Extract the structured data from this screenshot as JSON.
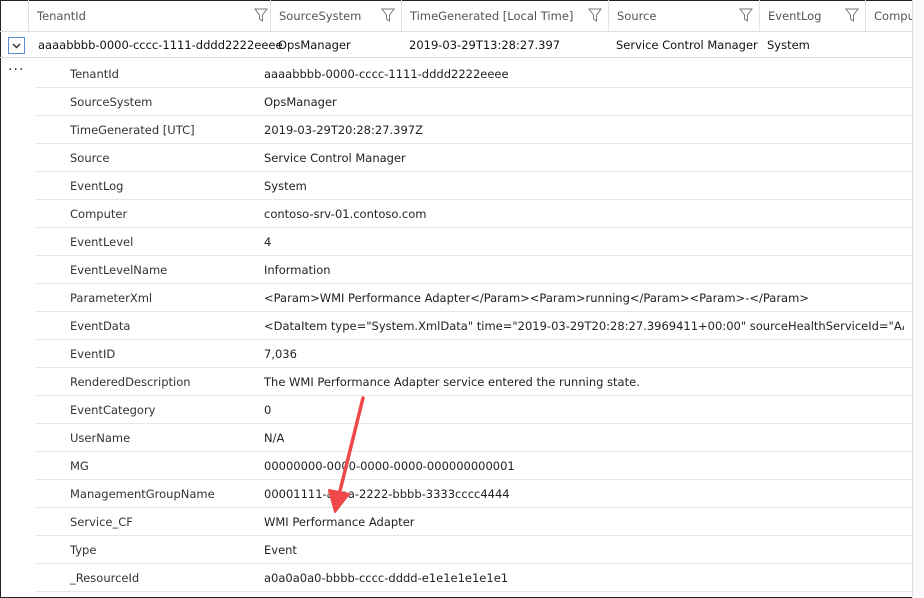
{
  "columns": [
    "TenantId",
    "SourceSystem",
    "TimeGenerated [Local Time]",
    "Source",
    "EventLog",
    "Compute"
  ],
  "main_row": [
    "aaaabbbb-0000-cccc-1111-dddd2222eeee",
    "OpsManager",
    "2019-03-29T13:28:27.397",
    "Service Control Manager",
    "System"
  ],
  "more_label": "···",
  "details": [
    {
      "label": "TenantId",
      "value": "aaaabbbb-0000-cccc-1111-dddd2222eeee"
    },
    {
      "label": "SourceSystem",
      "value": "OpsManager"
    },
    {
      "label": "TimeGenerated [UTC]",
      "value": "2019-03-29T20:28:27.397Z"
    },
    {
      "label": "Source",
      "value": "Service Control Manager"
    },
    {
      "label": "EventLog",
      "value": "System"
    },
    {
      "label": "Computer",
      "value": "contoso-srv-01.contoso.com"
    },
    {
      "label": "EventLevel",
      "value": "4"
    },
    {
      "label": "EventLevelName",
      "value": "Information"
    },
    {
      "label": "ParameterXml",
      "value": "<Param>WMI Performance Adapter</Param><Param>running</Param><Param>-</Param>"
    },
    {
      "label": "EventData",
      "value": "<DataItem type=\"System.XmlData\" time=\"2019-03-29T20:28:27.3969411+00:00\" sourceHealthServiceId=\"AAAAAAA-"
    },
    {
      "label": "EventID",
      "value": "7,036"
    },
    {
      "label": "RenderedDescription",
      "value": "The WMI Performance Adapter service entered the running state."
    },
    {
      "label": "EventCategory",
      "value": "0"
    },
    {
      "label": "UserName",
      "value": "N/A"
    },
    {
      "label": "MG",
      "value": "00000000-0000-0000-0000-000000000001"
    },
    {
      "label": "ManagementGroupName",
      "value": "00001111-aaaa-2222-bbbb-3333cccc4444"
    },
    {
      "label": "Service_CF",
      "value": "WMI Performance Adapter"
    },
    {
      "label": "Type",
      "value": "Event"
    },
    {
      "label": "_ResourceId",
      "value": "a0a0a0a0-bbbb-cccc-dddd-e1e1e1e1e1e1"
    }
  ],
  "annotation_color": "#f04848"
}
